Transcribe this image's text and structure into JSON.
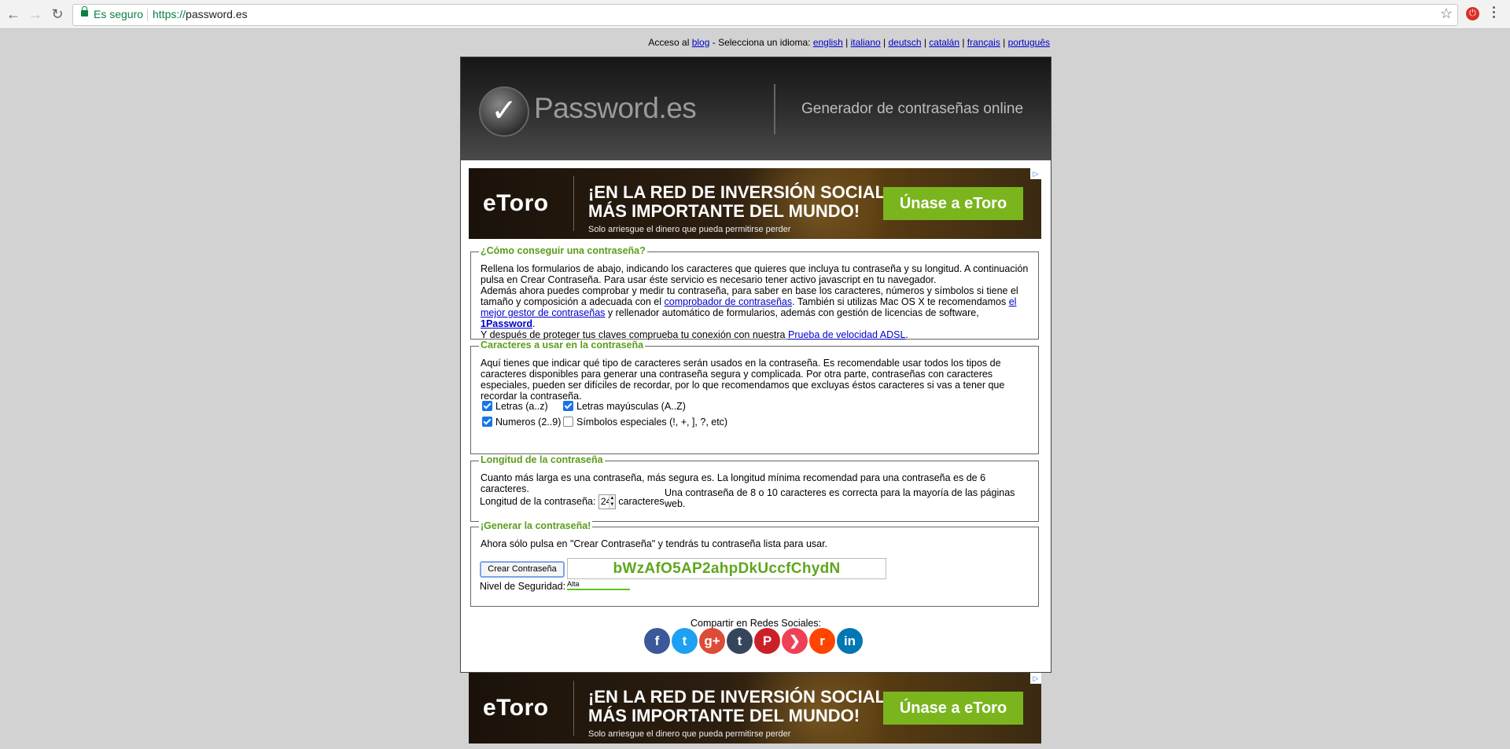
{
  "browser": {
    "secure_label": "Es seguro",
    "url_proto": "https://",
    "url_host": "password.es"
  },
  "langbar": {
    "prefix": "Acceso al",
    "blog": "blog",
    "select": "- Selecciona un idioma:",
    "languages": [
      "english",
      "italiano",
      "deutsch",
      "catalán",
      "français",
      "português"
    ]
  },
  "header": {
    "logo_text": "Password.es",
    "tagline": "Generador de contraseñas online"
  },
  "ad": {
    "brand": "eToro",
    "headline_1": "¡EN LA RED DE INVERSIÓN SOCIAL",
    "headline_2": "MÁS IMPORTANTE DEL MUNDO!",
    "sub": "Solo arriesgue el dinero que pueda permitirse perder",
    "cta": "Únase a eToro"
  },
  "how": {
    "legend": "¿Cómo conseguir una contraseña?",
    "p1": "Rellena los formularios de abajo, indicando los caracteres que quieres que incluya tu contraseña y su longitud. A continuación pulsa en Crear Contraseña. Para usar éste servicio es necesario tener activo javascript en tu navegador.",
    "p2a": "Además ahora puedes comprobar y medir tu contraseña, para saber en base los caracteres, números y símbolos si tiene el tamaño y composición a adecuada con el",
    "link_checker": "comprobador de contraseñas",
    "p2b": ". También si utilizas Mac OS X te recomendamos",
    "link_manager": "el mejor gestor de contraseñas",
    "p2c": "y rellenador automático de formularios, además con gestión de licencias de software,",
    "link_1password": "1Password",
    "p2d": ".",
    "p3a": "Y después de proteger tus claves comprueba tu conexión con nuestra",
    "link_speed": "Prueba de velocidad ADSL",
    "p3b": "."
  },
  "chars": {
    "legend": "Caracteres a usar en la contraseña",
    "text": "Aquí tienes que indicar qué tipo de caracteres serán usados en la contraseña. Es recomendable usar todos los tipos de caracteres disponibles para generar una contraseña segura y complicada. Por otra parte, contraseñas con caracteres especiales, pueden ser difíciles de recordar, por lo que recomendamos que excluyas éstos caracteres si vas a tener que recordar la contraseña.",
    "options": [
      {
        "label": "Letras (a..z)",
        "checked": true
      },
      {
        "label": "Letras mayúsculas (A..Z)",
        "checked": true
      },
      {
        "label": "Numeros (2..9)",
        "checked": true
      },
      {
        "label": "Símbolos especiales (!, +, ], ?, etc)",
        "checked": false
      }
    ]
  },
  "length": {
    "legend": "Longitud de la contraseña",
    "text": "Cuanto más larga es una contraseña, más segura es. La longitud mínima recomendad para una contraseña es de 6 caracteres.",
    "label": "Longitud de la contraseña:",
    "value": "24",
    "unit": "caracteres",
    "note": "Una contraseña de 8 o 10 caracteres es correcta para la mayoría de las páginas web."
  },
  "generate": {
    "legend": "¡Generar la contraseña!",
    "text": "Ahora sólo pulsa en \"Crear Contraseña\" y tendrás tu contraseña lista para usar.",
    "button": "Crear Contraseña",
    "password": "bWzAfO5AP2ahpDkUccfChydN",
    "security_label": "Nivel de Seguridad:",
    "security_value": "Alta"
  },
  "share": {
    "label": "Compartir en Redes Sociales:",
    "networks": [
      {
        "name": "facebook",
        "glyph": "f",
        "color": "#3b5998"
      },
      {
        "name": "twitter",
        "glyph": "t",
        "color": "#1da1f2"
      },
      {
        "name": "google-plus",
        "glyph": "g+",
        "color": "#dd4b39"
      },
      {
        "name": "tumblr",
        "glyph": "t",
        "color": "#35465c"
      },
      {
        "name": "pinterest",
        "glyph": "P",
        "color": "#cb2027"
      },
      {
        "name": "pocket",
        "glyph": "❯",
        "color": "#ef4056"
      },
      {
        "name": "reddit",
        "glyph": "r",
        "color": "#ff4500"
      },
      {
        "name": "linkedin",
        "glyph": "in",
        "color": "#0077b5"
      }
    ]
  }
}
